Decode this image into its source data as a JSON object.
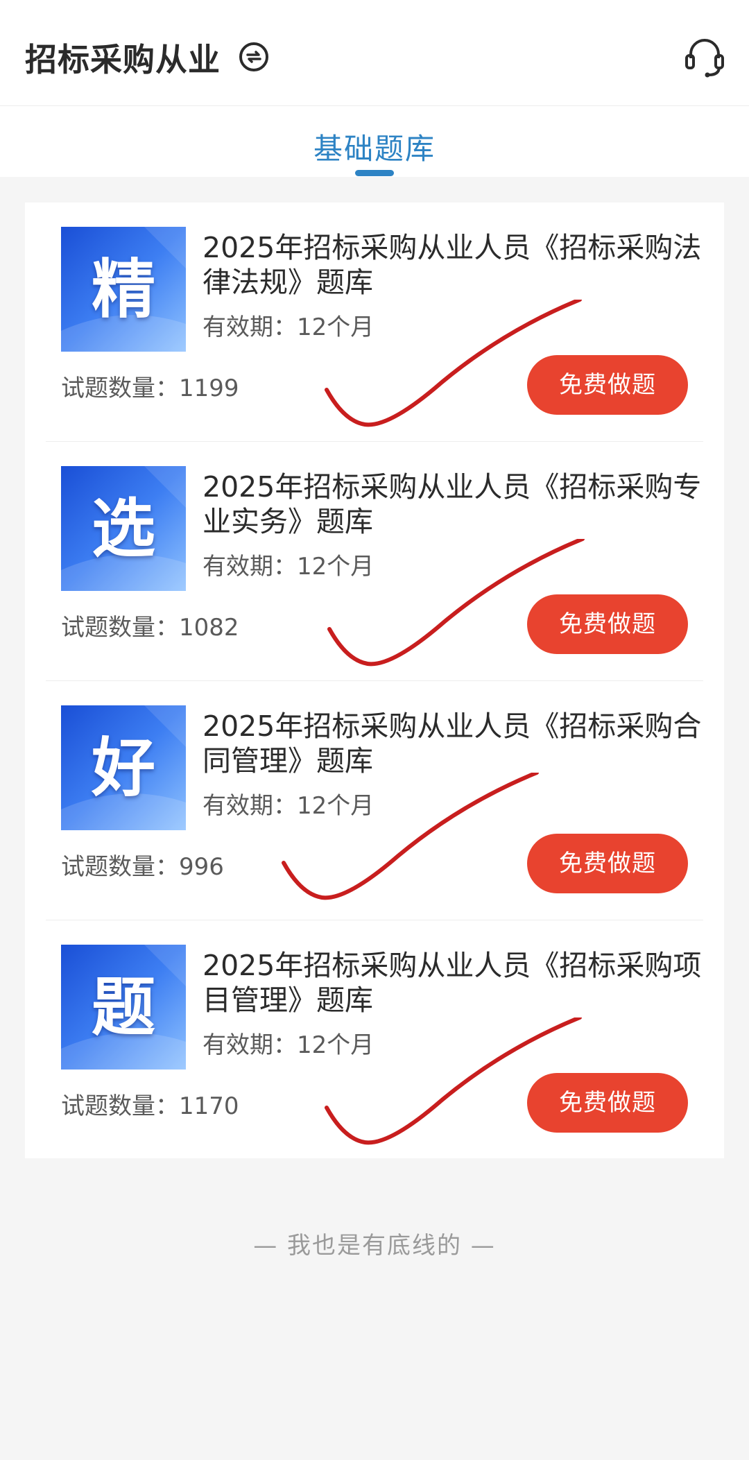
{
  "header": {
    "title": "招标采购从业",
    "switch_icon": "switch-icon",
    "service_icon": "headset-icon"
  },
  "tabs": [
    {
      "label": "基础题库",
      "active": true
    }
  ],
  "colors": {
    "accent": "#2d83c4",
    "button": "#e8432f",
    "check_mark": "#c81e1e"
  },
  "items": [
    {
      "cover_char": "精",
      "title": "2025年招标采购从业人员《招标采购法律法规》题库",
      "validity": "有效期：12个月",
      "count": "试题数量：1199",
      "button": "免费做题"
    },
    {
      "cover_char": "选",
      "title": "2025年招标采购从业人员《招标采购专业实务》题库",
      "validity": "有效期：12个月",
      "count": "试题数量：1082",
      "button": "免费做题"
    },
    {
      "cover_char": "好",
      "title": "2025年招标采购从业人员《招标采购合同管理》题库",
      "validity": "有效期：12个月",
      "count": "试题数量：996",
      "button": "免费做题"
    },
    {
      "cover_char": "题",
      "title": "2025年招标采购从业人员《招标采购项目管理》题库",
      "validity": "有效期：12个月",
      "count": "试题数量：1170",
      "button": "免费做题"
    }
  ],
  "footer": {
    "note": "—  我也是有底线的  —"
  }
}
